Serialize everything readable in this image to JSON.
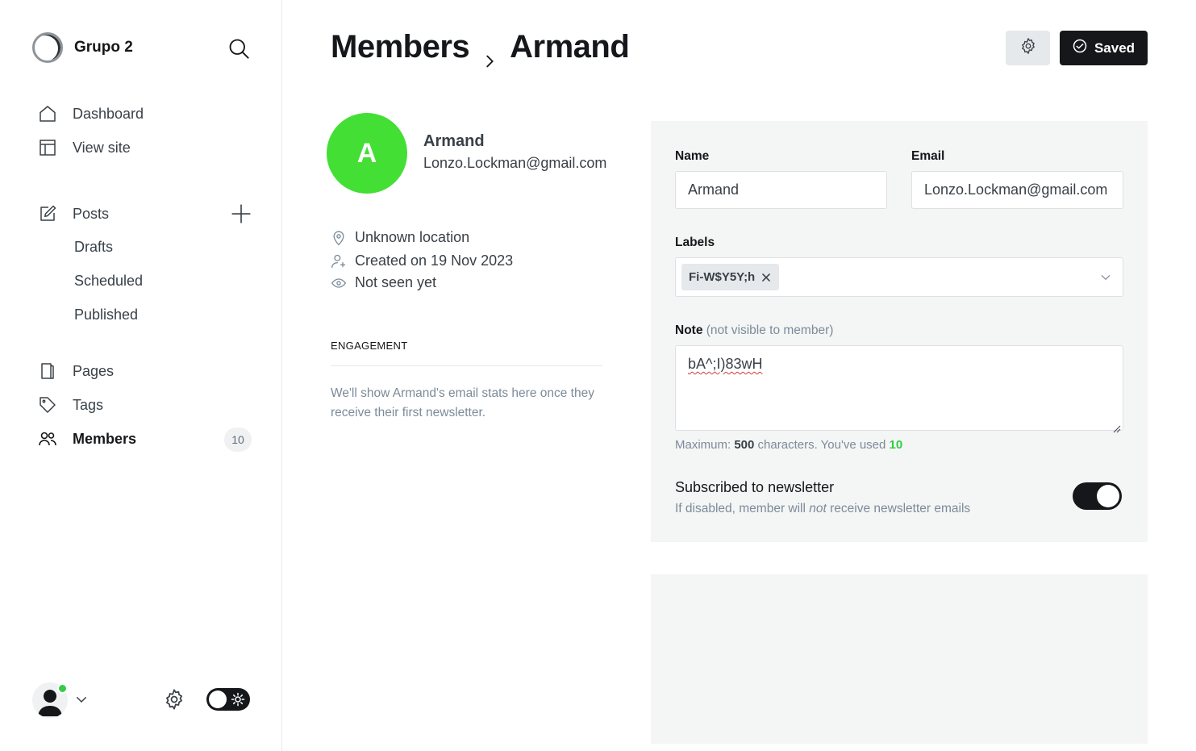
{
  "app": {
    "site_name": "Grupo 2"
  },
  "sidebar": {
    "nav": {
      "dashboard": "Dashboard",
      "view_site": "View site",
      "posts": "Posts",
      "drafts": "Drafts",
      "scheduled": "Scheduled",
      "published": "Published",
      "pages": "Pages",
      "tags": "Tags",
      "members": "Members",
      "members_count": "10"
    }
  },
  "header": {
    "breadcrumb_parent": "Members",
    "breadcrumb_current": "Armand",
    "saved_label": "Saved"
  },
  "member": {
    "avatar_initial": "A",
    "name": "Armand",
    "email": "Lonzo.Lockman@gmail.com",
    "location": "Unknown location",
    "created": "Created on 19 Nov 2023",
    "last_seen": "Not seen yet"
  },
  "engagement": {
    "title": "ENGAGEMENT",
    "text": "We'll show Armand's email stats here once they receive their first newsletter."
  },
  "form": {
    "name_label": "Name",
    "name_value": "Armand",
    "email_label": "Email",
    "email_value": "Lonzo.Lockman@gmail.com",
    "labels_label": "Labels",
    "label_chip": "Fi-W$Y5Y;h",
    "note_label": "Note",
    "note_hint": "(not visible to member)",
    "note_value": "bA^;I)83wH",
    "counter_prefix": "Maximum:",
    "counter_max": "500",
    "counter_mid": "characters. You've used",
    "counter_used": "10",
    "newsletter_title": "Subscribed to newsletter",
    "newsletter_desc_1": "If disabled, member will",
    "newsletter_desc_not": "not",
    "newsletter_desc_2": "receive newsletter emails",
    "newsletter_subscribed": true
  },
  "colors": {
    "accent_green": "#30cf43",
    "avatar_green": "#43df34",
    "dark": "#15171a"
  },
  "icons": [
    "search-icon",
    "home-icon",
    "layout-icon",
    "edit-icon",
    "plus-icon",
    "page-icon",
    "tag-icon",
    "members-icon",
    "gear-icon",
    "sun-icon",
    "chevron-right-icon",
    "check-circle-icon",
    "location-icon",
    "user-add-icon",
    "eye-icon",
    "close-icon",
    "chevron-down-icon"
  ]
}
